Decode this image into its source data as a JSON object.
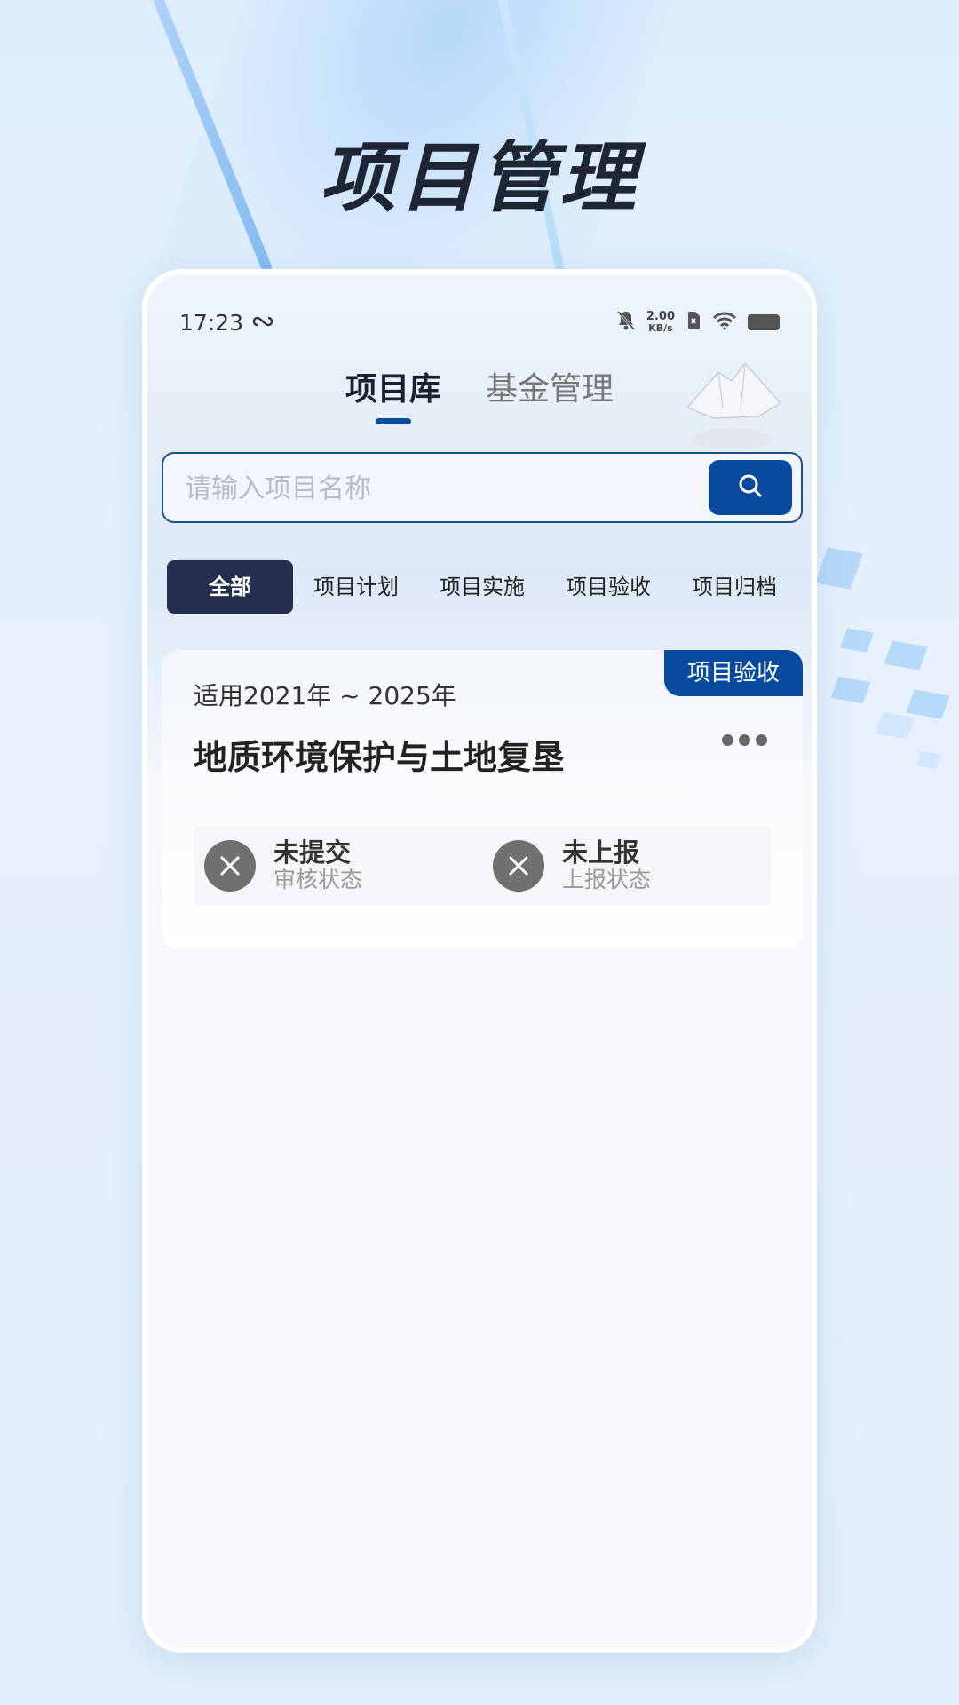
{
  "hero": {
    "title": "项目管理"
  },
  "status_bar": {
    "time": "17:23",
    "speed_value": "2.00",
    "speed_unit": "KB/s"
  },
  "tabs": [
    {
      "label": "项目库",
      "active": true
    },
    {
      "label": "基金管理",
      "active": false
    }
  ],
  "search": {
    "placeholder": "请输入项目名称",
    "value": "",
    "button_icon": "search-icon"
  },
  "filters": [
    {
      "label": "全部",
      "active": true
    },
    {
      "label": "项目计划",
      "active": false
    },
    {
      "label": "项目实施",
      "active": false
    },
    {
      "label": "项目验收",
      "active": false
    },
    {
      "label": "项目归档",
      "active": false
    }
  ],
  "card": {
    "badge": "项目验收",
    "subtitle": "适用2021年 ~ 2025年",
    "title": "地质环境保护与土地复垦",
    "more_icon": "more-icon",
    "statuses": [
      {
        "value": "未提交",
        "label": "审核状态",
        "icon": "close-icon"
      },
      {
        "value": "未上报",
        "label": "上报状态",
        "icon": "close-icon"
      }
    ]
  },
  "colors": {
    "accent": "#0a4a9e",
    "chip_active": "#242f4d",
    "status_icon": "#707070"
  }
}
